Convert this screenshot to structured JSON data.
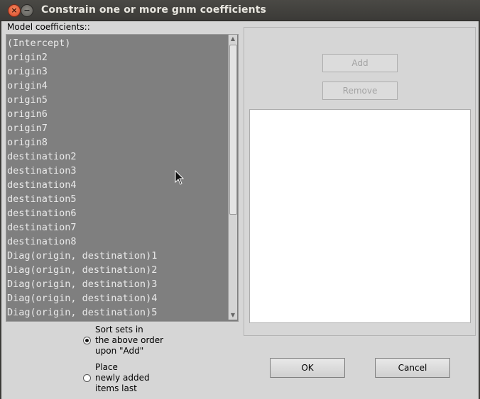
{
  "window": {
    "title": "Constrain one or more gnm coefficients"
  },
  "left": {
    "label": "Model coefficients::",
    "items": [
      "(Intercept)",
      "origin2",
      "origin3",
      "origin4",
      "origin5",
      "origin6",
      "origin7",
      "origin8",
      "destination2",
      "destination3",
      "destination4",
      "destination5",
      "destination6",
      "destination7",
      "destination8",
      "Diag(origin, destination)1",
      "Diag(origin, destination)2",
      "Diag(origin, destination)3",
      "Diag(origin, destination)4",
      "Diag(origin, destination)5"
    ]
  },
  "right": {
    "add_label": "Add",
    "remove_label": "Remove"
  },
  "options": {
    "sort": {
      "line1": "Sort sets in",
      "line2": "the above order",
      "line3": "upon \"Add\"",
      "selected": true
    },
    "place": {
      "line1": "Place",
      "line2": "newly added",
      "line3": "items last",
      "selected": false
    }
  },
  "buttons": {
    "ok": "OK",
    "cancel": "Cancel"
  }
}
